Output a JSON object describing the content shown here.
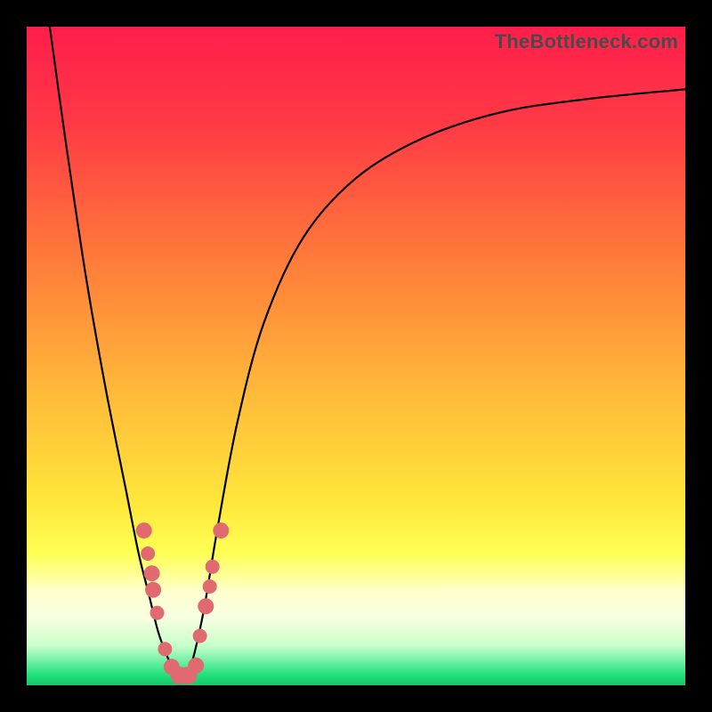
{
  "watermark": "TheBottleneck.com",
  "colors": {
    "top": "#ff1e4b",
    "mid1": "#ff6a3c",
    "mid2": "#ffc23a",
    "mid3": "#fff13a",
    "pale": "#ffffb0",
    "green": "#1fe07a",
    "black": "#000000",
    "dot": "#e06a6f"
  },
  "chart_data": {
    "type": "line",
    "title": "",
    "xlabel": "",
    "ylabel": "",
    "xlim": [
      0,
      1
    ],
    "ylim": [
      0,
      1
    ],
    "series": [
      {
        "name": "curve",
        "x": [
          0.035,
          0.06,
          0.09,
          0.12,
          0.15,
          0.17,
          0.185,
          0.2,
          0.215,
          0.225,
          0.235,
          0.245,
          0.255,
          0.27,
          0.29,
          0.32,
          0.36,
          0.42,
          0.5,
          0.6,
          0.72,
          0.85,
          1.0
        ],
        "y": [
          1.0,
          0.82,
          0.62,
          0.45,
          0.3,
          0.2,
          0.14,
          0.08,
          0.04,
          0.02,
          0.01,
          0.02,
          0.05,
          0.12,
          0.24,
          0.4,
          0.55,
          0.68,
          0.77,
          0.83,
          0.87,
          0.89,
          0.905
        ]
      }
    ],
    "markers": [
      {
        "x": 0.178,
        "y": 0.235,
        "r": 9
      },
      {
        "x": 0.184,
        "y": 0.2,
        "r": 8
      },
      {
        "x": 0.19,
        "y": 0.17,
        "r": 9
      },
      {
        "x": 0.192,
        "y": 0.145,
        "r": 9
      },
      {
        "x": 0.198,
        "y": 0.11,
        "r": 8
      },
      {
        "x": 0.21,
        "y": 0.055,
        "r": 8
      },
      {
        "x": 0.22,
        "y": 0.028,
        "r": 9
      },
      {
        "x": 0.232,
        "y": 0.015,
        "r": 10
      },
      {
        "x": 0.245,
        "y": 0.015,
        "r": 10
      },
      {
        "x": 0.257,
        "y": 0.03,
        "r": 9
      },
      {
        "x": 0.263,
        "y": 0.075,
        "r": 8
      },
      {
        "x": 0.272,
        "y": 0.12,
        "r": 9
      },
      {
        "x": 0.278,
        "y": 0.15,
        "r": 8
      },
      {
        "x": 0.282,
        "y": 0.18,
        "r": 8
      },
      {
        "x": 0.295,
        "y": 0.235,
        "r": 9
      }
    ],
    "gradient_stops": [
      {
        "offset": 0.0,
        "color": "#ff1e4b"
      },
      {
        "offset": 0.15,
        "color": "#ff3a45"
      },
      {
        "offset": 0.35,
        "color": "#ff7a3a"
      },
      {
        "offset": 0.55,
        "color": "#ffb83a"
      },
      {
        "offset": 0.72,
        "color": "#ffe63a"
      },
      {
        "offset": 0.8,
        "color": "#ffff55"
      },
      {
        "offset": 0.86,
        "color": "#ffffd0"
      },
      {
        "offset": 0.9,
        "color": "#f5ffe0"
      },
      {
        "offset": 0.94,
        "color": "#c8ffca"
      },
      {
        "offset": 0.965,
        "color": "#6af0a0"
      },
      {
        "offset": 0.985,
        "color": "#1fe07a"
      },
      {
        "offset": 1.0,
        "color": "#17c968"
      }
    ]
  }
}
